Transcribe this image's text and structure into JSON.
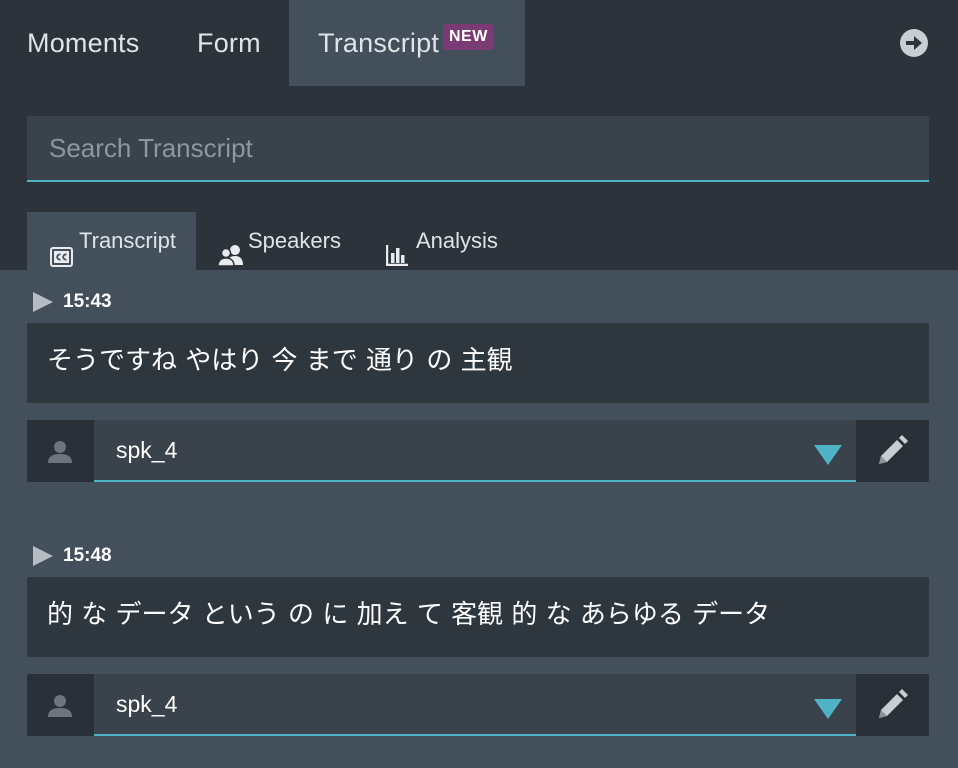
{
  "top_tabs": {
    "moments": "Moments",
    "form": "Form",
    "transcript": "Transcript",
    "new_badge": "NEW"
  },
  "search": {
    "placeholder": "Search Transcript",
    "value": ""
  },
  "sub_tabs": {
    "transcript": "Transcript",
    "speakers": "Speakers",
    "analysis": "Analysis",
    "active": "transcript"
  },
  "entries": [
    {
      "time": "15:43",
      "text": "そうですね やはり 今 まで 通り の 主観",
      "speaker": "spk_4"
    },
    {
      "time": "15:48",
      "text": "的 な データ という の に 加え て 客観 的 な あらゆる データ",
      "speaker": "spk_4"
    }
  ],
  "colors": {
    "background": "#434f5b",
    "header": "#2c333b",
    "accent": "#4fb3c6",
    "badge": "#7a3a73"
  },
  "icons": {
    "go": "arrow-right-circle-icon",
    "closed_captions": "closed-captions-icon",
    "speakers": "people-icon",
    "analysis": "bar-chart-icon",
    "play": "play-icon",
    "person": "person-icon",
    "dropdown": "caret-down-icon",
    "edit": "pencil-icon"
  }
}
